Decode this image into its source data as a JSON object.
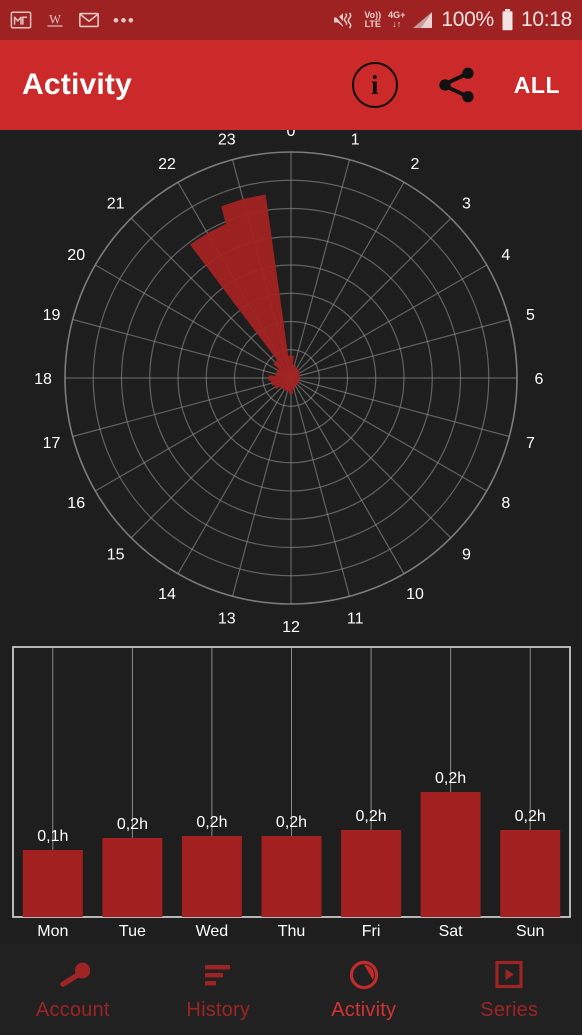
{
  "status_bar": {
    "background": "#9E2222",
    "left_icons": [
      "gmail-icon",
      "wikipedia-icon",
      "email-icon",
      "more-icon"
    ],
    "more_glyph": "•••",
    "mute_icon": "mute-icon",
    "volte_line1": "Vo))",
    "volte_line2": "LTE",
    "network_label": "4G+",
    "network_arrows": "↓↑",
    "signal_icon": "signal-bars-icon",
    "battery_percent": "100%",
    "battery_icon": "battery-full-icon",
    "clock": "10:18"
  },
  "app_bar": {
    "background": "#CC2A2A",
    "title": "Activity",
    "info_glyph": "i",
    "info_label": "info-button",
    "share_label": "share-button",
    "filter_label": "ALL"
  },
  "chart_data": [
    {
      "type": "polar",
      "name": "activity-by-hour-polar",
      "title": "",
      "grid": true,
      "grid_rings": 8,
      "sector_count": 24,
      "categories": [
        "0",
        "1",
        "2",
        "3",
        "4",
        "5",
        "6",
        "7",
        "8",
        "9",
        "10",
        "11",
        "12",
        "13",
        "14",
        "15",
        "16",
        "17",
        "18",
        "19",
        "20",
        "21",
        "22",
        "23"
      ],
      "values": [
        0.1,
        0.06,
        0.05,
        0.05,
        0.04,
        0.04,
        0.04,
        0.04,
        0.04,
        0.04,
        0.04,
        0.05,
        0.07,
        0.06,
        0.06,
        0.06,
        0.08,
        0.09,
        0.1,
        0.07,
        0.07,
        0.1,
        0.74,
        0.82
      ],
      "rmax": 1.0,
      "series_color": "#A32323",
      "grid_color": "#8c8c8c",
      "label_color": "#ffffff",
      "background": "#1e1e1e"
    },
    {
      "type": "bar",
      "name": "activity-by-weekday-bars",
      "title": "",
      "xlabel": "",
      "ylabel": "",
      "categories": [
        "Mon",
        "Tue",
        "Wed",
        "Thu",
        "Fri",
        "Sat",
        "Sun"
      ],
      "values": [
        0.1,
        0.2,
        0.2,
        0.2,
        0.2,
        0.2,
        0.2
      ],
      "value_labels": [
        "0,1h",
        "0,2h",
        "0,2h",
        "0,2h",
        "0,2h",
        "0,2h",
        "0,2h"
      ],
      "bar_pixel_heights": [
        67,
        79,
        81,
        81,
        87,
        125,
        87
      ],
      "ylim": [
        0,
        0.29
      ],
      "grid": true,
      "bar_color": "#A32020",
      "frame_color": "#c8c8c8",
      "gridline_color": "#b0b0b0",
      "label_color": "#ffffff",
      "background": "#1e1e1e"
    }
  ],
  "bottom_nav": {
    "background": "#212121",
    "items": [
      {
        "label": "Account",
        "icon": "wrench-icon",
        "active": false
      },
      {
        "label": "History",
        "icon": "list-bars-icon",
        "active": false
      },
      {
        "label": "Activity",
        "icon": "clock-icon",
        "active": true
      },
      {
        "label": "Series",
        "icon": "play-square-icon",
        "active": false
      }
    ]
  }
}
